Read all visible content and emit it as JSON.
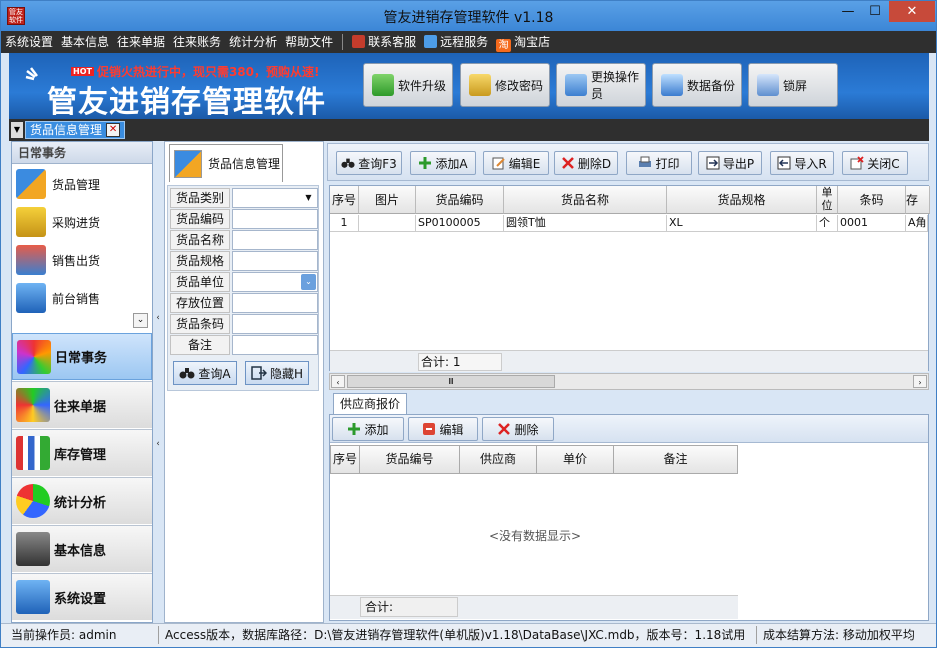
{
  "window": {
    "title": "管友进销存管理软件 v1.18",
    "icon_text": "管友软件",
    "min_glyph": "—",
    "max_glyph": "☐",
    "close_glyph": "✕"
  },
  "menu": {
    "items": [
      "系统设置",
      "基本信息",
      "往来单据",
      "往来账务",
      "统计分析",
      "帮助文件"
    ],
    "extras": [
      "联系客服",
      "远程服务",
      "淘宝店"
    ],
    "taobao_mark": "淘"
  },
  "banner": {
    "hot_tag": "HOT",
    "promo": "促销火热进行中，现只需380，预购从速!",
    "title": "管友进销存管理软件",
    "buttons": [
      "软件升级",
      "修改密码",
      "更换操作员",
      "数据备份",
      "锁屏"
    ]
  },
  "doc_tabs": {
    "dropdown_glyph": "▼",
    "active": "货品信息管理",
    "close_glyph": "✕"
  },
  "nav": {
    "header": "日常事务",
    "sub_items": [
      "货品管理",
      "采购进货",
      "销售出货",
      "前台销售"
    ],
    "scroll_glyph": "⌄",
    "groups": [
      "日常事务",
      "往来单据",
      "库存管理",
      "统计分析",
      "基本信息",
      "系统设置"
    ],
    "active_group": "日常事务"
  },
  "splitter": {
    "collapse_glyph": "‹"
  },
  "search_panel": {
    "tab_label": "货品信息管理",
    "fields": [
      {
        "label": "货品类别",
        "value": "",
        "control": "select"
      },
      {
        "label": "货品编码",
        "value": "",
        "control": "text"
      },
      {
        "label": "货品名称",
        "value": "",
        "control": "text"
      },
      {
        "label": "货品规格",
        "value": "",
        "control": "text"
      },
      {
        "label": "货品单位",
        "value": "",
        "control": "combo"
      },
      {
        "label": "存放位置",
        "value": "",
        "control": "text"
      },
      {
        "label": "货品条码",
        "value": "",
        "control": "text"
      },
      {
        "label": "备注",
        "value": "",
        "control": "text"
      }
    ],
    "select_glyph": "▼",
    "combo_glyph": "⌄",
    "query_btn": "查询A",
    "hide_btn": "隐藏H"
  },
  "toolbar": {
    "buttons": [
      "查询F3",
      "添加A",
      "编辑E",
      "删除D",
      "打印",
      "导出P",
      "导入R",
      "关闭C"
    ]
  },
  "grid": {
    "columns": [
      "序号",
      "图片",
      "货品编码",
      "货品名称",
      "货品规格",
      "单位",
      "条码",
      "存放"
    ],
    "rows": [
      [
        "1",
        "",
        "SP0100005",
        "圆领T恤",
        "XL",
        "个",
        "0001",
        "A角"
      ]
    ],
    "summary": "合计: 1",
    "hscroll_grip": "Ⅲ",
    "scroll_left": "‹",
    "scroll_right": "›"
  },
  "supplier": {
    "tab": "供应商报价",
    "buttons": [
      "添加",
      "编辑",
      "删除"
    ],
    "columns": [
      "序号",
      "货品编号",
      "供应商",
      "单价",
      "备注"
    ],
    "empty_text": "<没有数据显示>",
    "summary": "合计:"
  },
  "status": {
    "operator": "当前操作员: admin",
    "db_info": "Access版本，数据库路径：D:\\管友进销存管理软件(单机版)v1.18\\DataBase\\JXC.mdb，版本号：1.18试用",
    "cost_method": "成本结算方法: 移动加权平均"
  },
  "colors": {
    "accent": "#3a8de0",
    "banner": "#2b7bd6",
    "promo": "#ff3b2f",
    "titlebar": "#4a90d9"
  }
}
